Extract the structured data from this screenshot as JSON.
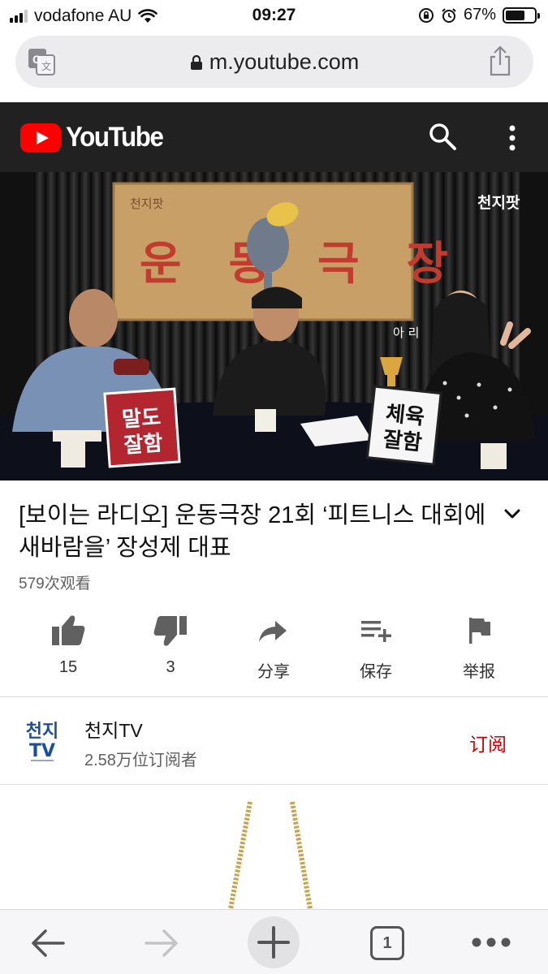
{
  "status_bar": {
    "carrier": "vodafone AU",
    "time": "09:27",
    "battery_percent": "67%",
    "battery_level": 0.67
  },
  "browser": {
    "url": "m.youtube.com"
  },
  "youtube": {
    "wordmark": "YouTube"
  },
  "video": {
    "title": "[보이는 라디오] 운동극장 21회 ‘피트니스 대회에 새바람을’ 장성제 대표",
    "views": "579次观看",
    "overlay": {
      "corner_logo": "천지팟",
      "backdrop_small": "천지팟",
      "backdrop_title": "운동극장",
      "sign_left": "말도 잘함",
      "sign_right": "체육 잘함",
      "name_tag": "아 리"
    }
  },
  "actions": {
    "like_count": "15",
    "dislike_count": "3",
    "share_label": "分享",
    "save_label": "保存",
    "report_label": "举报"
  },
  "channel": {
    "avatar_text": "천지",
    "avatar_text2": "TV",
    "name": "천지TV",
    "subscribers": "2.58万位订阅者",
    "subscribe_label": "订阅"
  },
  "toolbar": {
    "tab_count": "1"
  },
  "colors": {
    "youtube_red": "#ff0000",
    "subscribe_red": "#cc0000",
    "header_bg": "#212121"
  }
}
